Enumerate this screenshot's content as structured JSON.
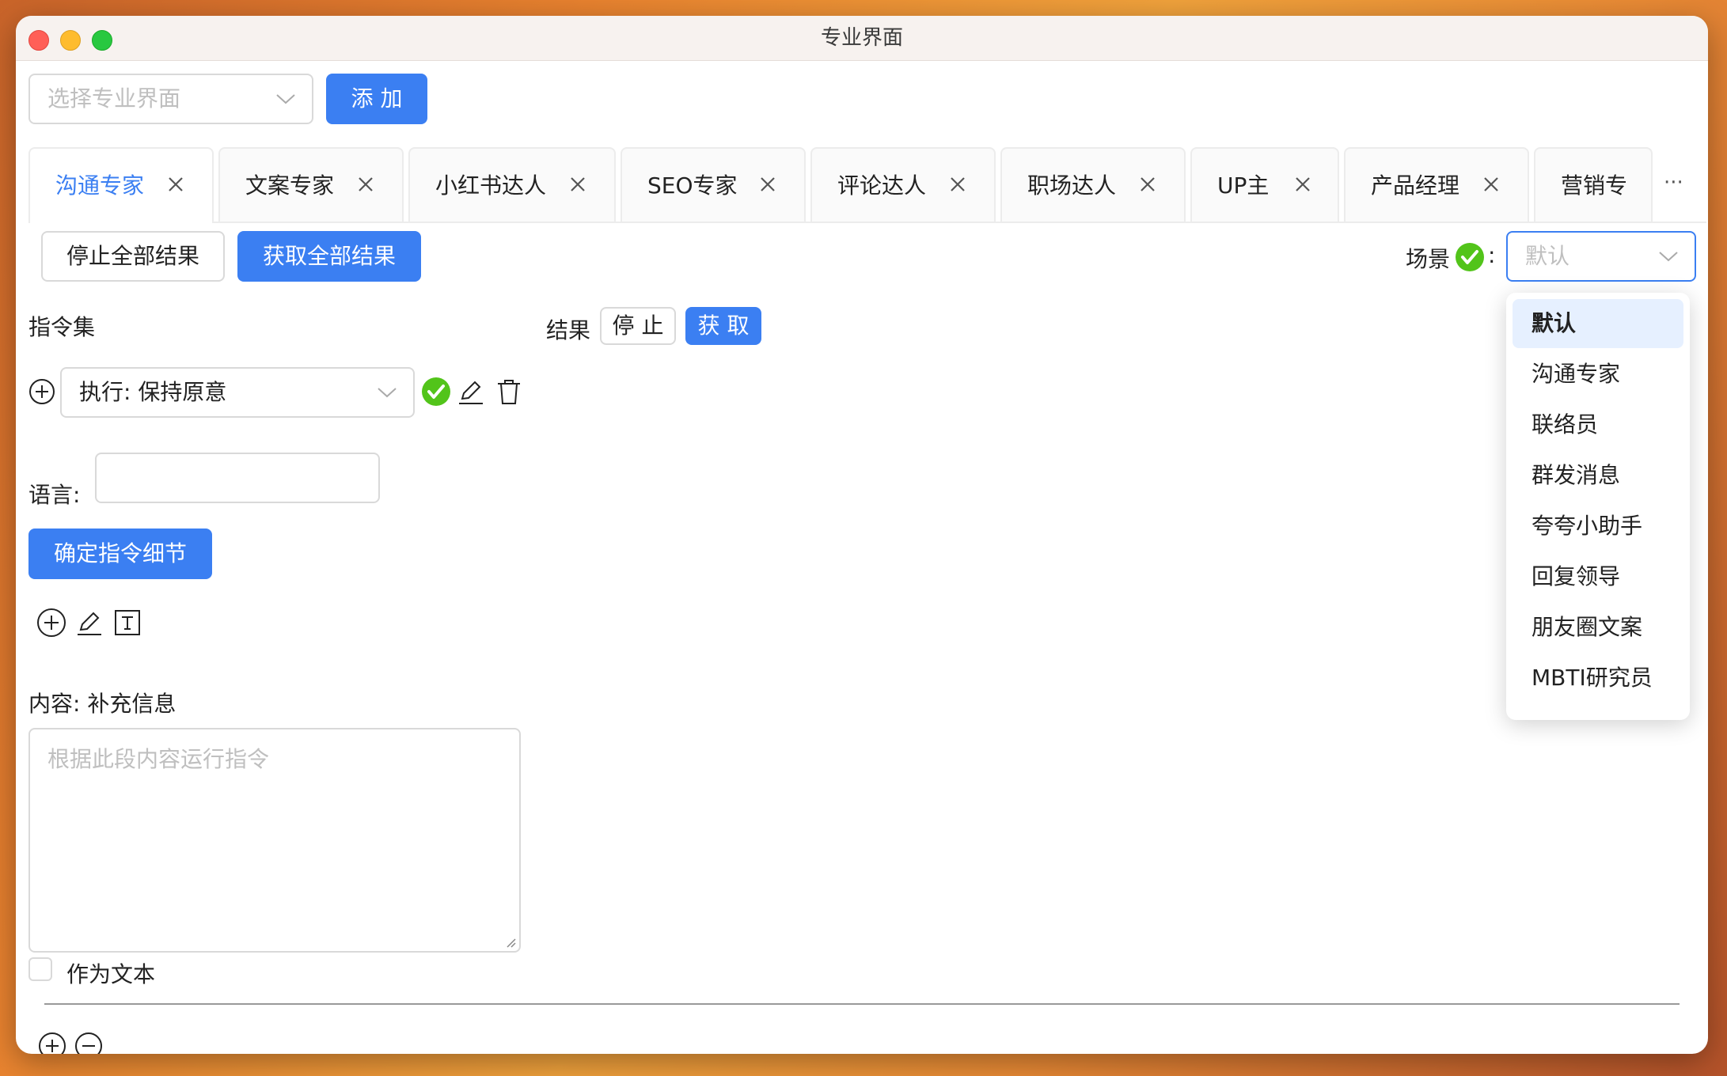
{
  "window": {
    "title": "专业界面"
  },
  "toolbar": {
    "select_placeholder": "选择专业界面",
    "add_label": "添 加"
  },
  "tabs": [
    {
      "label": "沟通专家",
      "active": true
    },
    {
      "label": "文案专家"
    },
    {
      "label": "小红书达人"
    },
    {
      "label": "SEO专家"
    },
    {
      "label": "评论达人"
    },
    {
      "label": "职场达人"
    },
    {
      "label": "UP主"
    },
    {
      "label": "产品经理"
    },
    {
      "label": "营销专"
    }
  ],
  "tabs_more": "···",
  "actions": {
    "stop_all": "停止全部结果",
    "get_all": "获取全部结果"
  },
  "scene": {
    "label": "场景",
    "colon": ":",
    "placeholder": "默认"
  },
  "instructions": {
    "title": "指令集",
    "select_value": "执行: 保持原意"
  },
  "result": {
    "label": "结果",
    "stop": "停 止",
    "get": "获 取"
  },
  "language": {
    "label": "语言:",
    "value": ""
  },
  "confirm_button": "确定指令细节",
  "content": {
    "label": "内容: 补充信息",
    "placeholder": "根据此段内容运行指令"
  },
  "as_text": {
    "label": "作为文本",
    "checked": false
  },
  "scene_options": [
    {
      "label": "默认",
      "selected": true
    },
    {
      "label": "沟通专家"
    },
    {
      "label": "联络员"
    },
    {
      "label": "群发消息"
    },
    {
      "label": "夸夸小助手"
    },
    {
      "label": "回复领导"
    },
    {
      "label": "朋友圈文案"
    },
    {
      "label": "MBTI研究员"
    }
  ],
  "colors": {
    "primary": "#3b7ff2",
    "success": "#52c41a",
    "border": "#d9d9d9"
  }
}
